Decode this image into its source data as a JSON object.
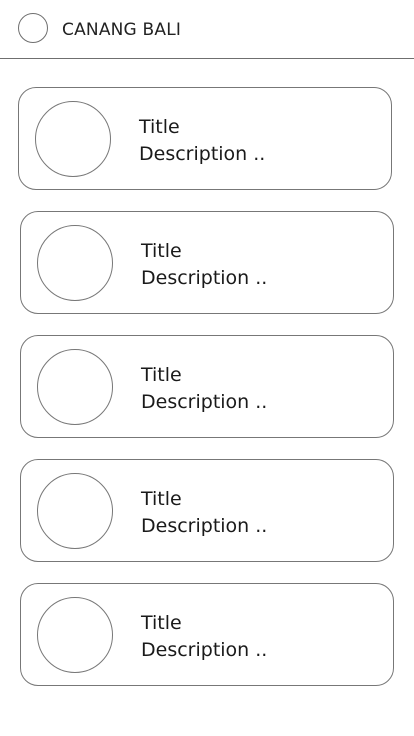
{
  "header": {
    "title": "CANANG BALI"
  },
  "cards": [
    {
      "title": "Title",
      "description": "Description .."
    },
    {
      "title": "Title",
      "description": "Description .."
    },
    {
      "title": "Title",
      "description": "Description .."
    },
    {
      "title": "Title",
      "description": "Description .."
    },
    {
      "title": "Title",
      "description": "Description .."
    }
  ],
  "colors": {
    "background": "#ffffff",
    "border": "#777777",
    "text": "#1a1a1a"
  }
}
